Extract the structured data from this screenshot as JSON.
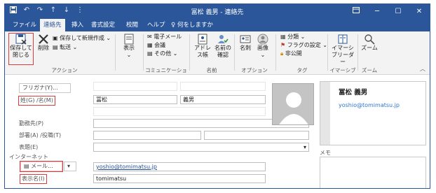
{
  "window": {
    "title": "冨松 義男 - 連絡先",
    "controls": [
      "ribbon-display-icon",
      "minimize-icon",
      "maximize-icon",
      "close-icon"
    ]
  },
  "quick_access": [
    "save-icon",
    "undo-icon",
    "redo-icon",
    "up-icon",
    "down-icon",
    "customize-icon"
  ],
  "tabs": [
    "ファイル",
    "連絡先",
    "挿入",
    "書式設定",
    "校閲",
    "ヘルプ",
    "何をしますか"
  ],
  "active_tab": "連絡先",
  "ribbon": {
    "actions": {
      "save_close_line1": "保存して",
      "save_close_line2": "閉じる",
      "delete": "削除",
      "save_new": "保存して新規作成",
      "forward": "転送",
      "group_label": "アクション"
    },
    "show": {
      "label": "表示"
    },
    "communication": {
      "email": "電子メール",
      "meeting": "会議",
      "more": "その他",
      "group_label": "コミュニケーション"
    },
    "names": {
      "address_book": "アドレス帳",
      "check_names_line1": "名前の",
      "check_names_line2": "確認",
      "group_label": "名前"
    },
    "options": {
      "business_card": "名刺",
      "picture": "画像",
      "group_label": "オプション"
    },
    "tags": {
      "categorize": "分類",
      "follow_up": "フラグの設定",
      "private": "非公開",
      "group_label": "タグ"
    },
    "immersive": {
      "reader_line1": "イマーシ",
      "reader_line2": "ブリーダー",
      "group_label": "イマーシブ"
    },
    "zoom": {
      "label": "ズーム",
      "group_label": "ズーム"
    }
  },
  "form": {
    "furigana_button": "フリガナ(Y)...",
    "full_name_label": "姓(G) /名(M)",
    "last_name": "冨松",
    "first_name": "義男",
    "company_label": "勤務先(P)",
    "dept_label": "部署(A) /役職(T)",
    "file_as_label": "表題(E)",
    "internet_label": "インターネット",
    "email_button": "メール...",
    "email_value": "yoshio@tomimatsu.jp",
    "display_as_label": "表示名(I)",
    "display_as_value": "tomimatsu",
    "memo_label": "メモ"
  },
  "card": {
    "name": "冨松 義男",
    "email": "yoshio@tomimatsu.jp"
  },
  "colors": {
    "accent": "#2b579a",
    "highlight": "#e03a3a",
    "link": "#2e74c9"
  }
}
